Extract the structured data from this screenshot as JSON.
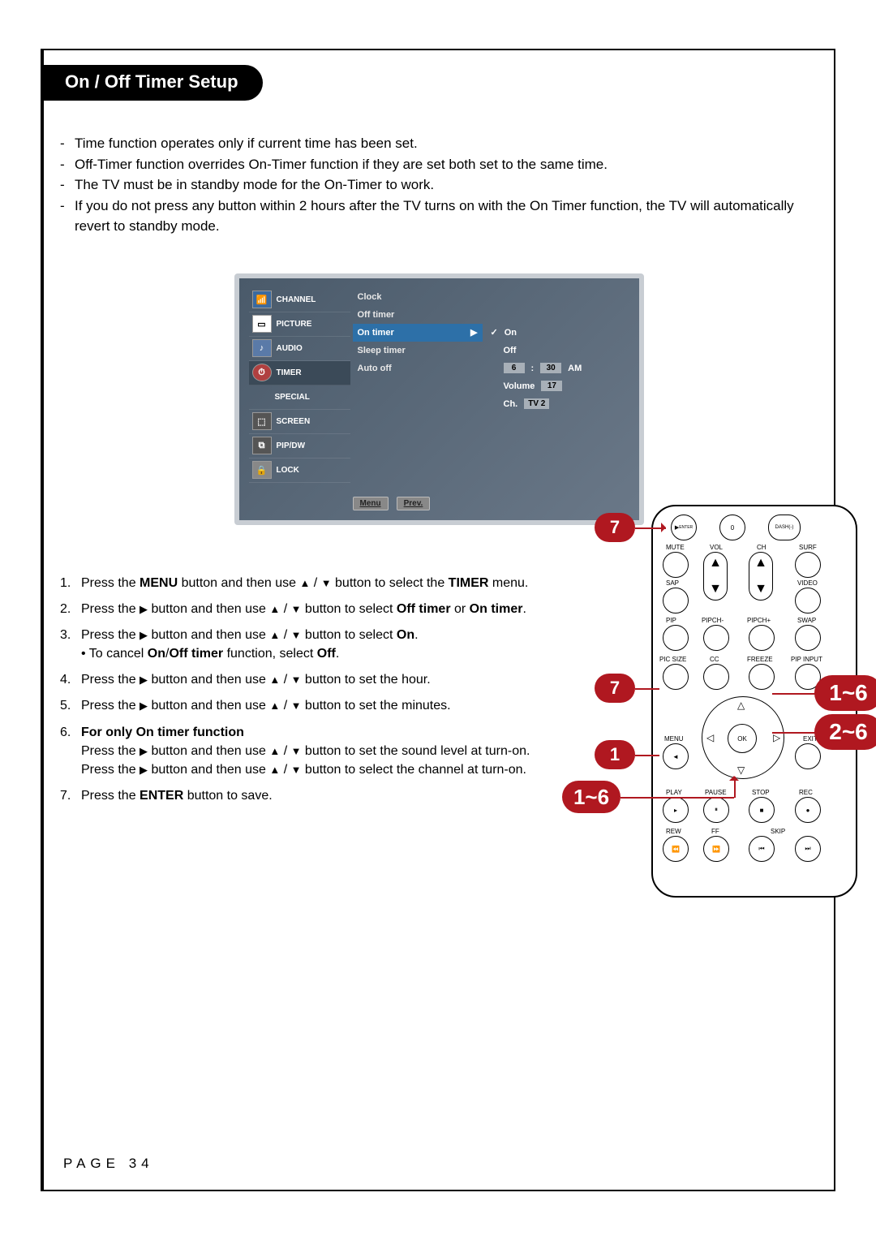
{
  "title": "On / Off Timer Setup",
  "intro": [
    "Time function operates only if current time has been set.",
    "Off-Timer function overrides On-Timer function if they are set both set to the same time.",
    "The TV must be in standby mode for the On-Timer to work.",
    "If you do not press any button within 2 hours after the TV turns on with the On Timer function, the TV will automatically revert to standby mode."
  ],
  "osd": {
    "side": [
      "CHANNEL",
      "PICTURE",
      "AUDIO",
      "TIMER",
      "SPECIAL",
      "SCREEN",
      "PIP/DW",
      "LOCK"
    ],
    "active_side_index": 3,
    "center": [
      "Clock",
      "Off timer",
      "On timer",
      "Sleep timer",
      "Auto off"
    ],
    "highlight_index": 2,
    "arrow": "▶",
    "right_check": "✓",
    "right": {
      "on": "On",
      "off": "Off",
      "time_h": "6",
      "time_sep": ":",
      "time_m": "30",
      "ampm": "AM",
      "vol_label": "Volume",
      "vol_val": "17",
      "ch_label": "Ch.",
      "ch_val": "TV  2"
    },
    "footer": {
      "menu": "Menu",
      "prev": "Prev."
    }
  },
  "steps": {
    "s1a": "Press the ",
    "s1b": "MENU",
    "s1c": " button and then use ",
    "s1d": " button to select the ",
    "s1e": "TIMER",
    "s1f": " menu.",
    "s2a": "Press the ",
    "s2b": " button and then use ",
    "s2c": " button to select ",
    "s2d": "Off timer",
    "s2e": " or ",
    "s2f": "On timer",
    "s2g": ".",
    "s3a": "Press the ",
    "s3b": " button and then use ",
    "s3c": " button to select ",
    "s3d": "On",
    "s3e": ".",
    "s3f": "• To cancel ",
    "s3g": "On",
    "s3h": "/",
    "s3i": "Off timer",
    "s3j": " function, select ",
    "s3k": "Off",
    "s3l": ".",
    "s4a": "Press the ",
    "s4b": " button and then use ",
    "s4c": " button to set the hour.",
    "s5a": "Press the ",
    "s5b": " button and then use ",
    "s5c": " button to set the minutes.",
    "s6a": "For only ",
    "s6b": "On timer",
    "s6c": " function",
    "s6d": "Press the ",
    "s6e": " button and then use ",
    "s6f": " button to set the sound level at turn-on.",
    "s6g": "Press the ",
    "s6h": " button and then use ",
    "s6i": " button to select the channel at turn-on.",
    "s7a": "Press the ",
    "s7b": "ENTER",
    "s7c": " button to save.",
    "arrow_right": "▶",
    "arrow_up": "▲",
    "arrow_dn": "▼",
    "slash": " / "
  },
  "remote": {
    "enter": "ENTER",
    "zero": "0",
    "dash": "DASH(-)",
    "mute": "MUTE",
    "vol": "VOL",
    "ch": "CH",
    "surf": "SURF",
    "sap": "SAP",
    "video": "VIDEO",
    "pip": "PIP",
    "pipchm": "PIPCH-",
    "pipchp": "PIPCH+",
    "swap": "SWAP",
    "picsize": "PIC SIZE",
    "cc": "CC",
    "freeze": "FREEZE",
    "pipinput": "PIP INPUT",
    "menu": "MENU",
    "exit": "EXIT",
    "ok": "OK",
    "play": "PLAY",
    "pause": "PAUSE",
    "stop": "STOP",
    "rec": "REC",
    "rew": "REW",
    "ff": "FF",
    "skip": "SKIP",
    "play_glyph": "▸",
    "pause_glyph": "⏸",
    "stop_glyph": "■",
    "rec_glyph": "●",
    "rew_glyph": "⏮",
    "ff_glyph": "⏭",
    "skipl_glyph": "⏪",
    "skipr_glyph": "⏩",
    "tri_l": "◁",
    "tri_r": "▷",
    "tri_u": "△",
    "tri_d": "▽",
    "up": "▲",
    "dn": "▼"
  },
  "bubbles": {
    "b7a": "7",
    "b7b": "7",
    "b1": "1",
    "b1_6a": "1~6",
    "b1_6b": "1~6",
    "b2_6": "2~6"
  },
  "page_no": "PAGE 34"
}
